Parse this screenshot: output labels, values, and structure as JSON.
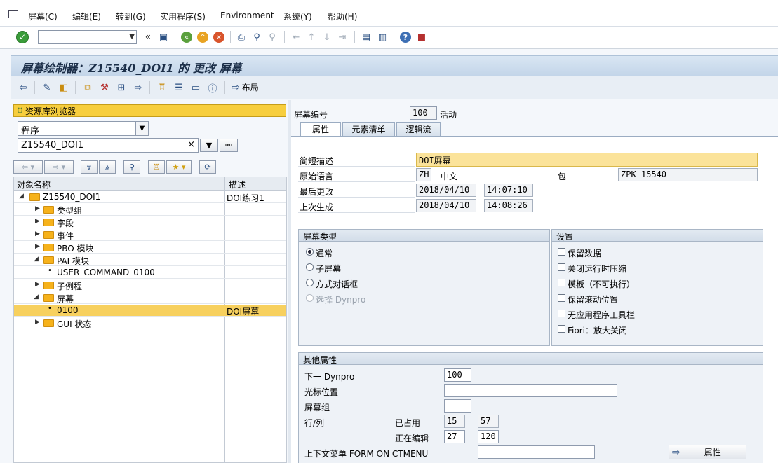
{
  "menu": [
    "屏幕(C)",
    "编辑(E)",
    "转到(G)",
    "实用程序(S)",
    "Environment",
    "系统(Y)",
    "帮助(H)"
  ],
  "title": "屏幕绘制器：Z15540_DOI1 的 更改 屏幕",
  "app_toolbar": {
    "layout_label": "布局"
  },
  "left": {
    "repo_browser": "资源库浏览器",
    "object_type": "程序",
    "object_name": "Z15540_DOI1",
    "col_name": "对象名称",
    "col_desc": "描述",
    "tree": [
      {
        "label": "Z15540_DOI1",
        "desc": "DOI练习1"
      },
      {
        "label": "类型组",
        "desc": ""
      },
      {
        "label": "字段",
        "desc": ""
      },
      {
        "label": "事件",
        "desc": ""
      },
      {
        "label": "PBO 模块",
        "desc": ""
      },
      {
        "label": "PAI 模块",
        "desc": ""
      },
      {
        "label": "USER_COMMAND_0100",
        "desc": ""
      },
      {
        "label": "子例程",
        "desc": ""
      },
      {
        "label": "屏幕",
        "desc": ""
      },
      {
        "label": "0100",
        "desc": "DOI屏幕"
      },
      {
        "label": "GUI 状态",
        "desc": ""
      }
    ]
  },
  "right": {
    "screen_no_label": "屏幕编号",
    "screen_no": "100",
    "status": "活动",
    "tabs": [
      "属性",
      "元素清单",
      "逻辑流"
    ],
    "short_desc_label": "简短描述",
    "short_desc": "DOI屏幕",
    "orig_lang_label": "原始语言",
    "orig_lang_code": "ZH",
    "orig_lang_name": "中文",
    "package_label": "包",
    "package": "ZPK_15540",
    "last_changed_label": "最后更改",
    "last_changed_date": "2018/04/10",
    "last_changed_time": "14:07:10",
    "last_gen_label": "上次生成",
    "last_gen_date": "2018/04/10",
    "last_gen_time": "14:08:26",
    "screen_type": {
      "header": "屏幕类型",
      "options": [
        "通常",
        "子屏幕",
        "方式对话框",
        "选择 Dynpro"
      ],
      "selected": 0
    },
    "settings": {
      "header": "设置",
      "options": [
        "保留数据",
        "关闭运行时压缩",
        "模板（不可执行）",
        "保留滚动位置",
        "无应用程序工具栏",
        "Fiori：放大关闭"
      ]
    },
    "other": {
      "header": "其他属性",
      "next_dynpro_label": "下一 Dynpro",
      "next_dynpro": "100",
      "cursor_label": "光标位置",
      "cursor": "",
      "screen_group_label": "屏幕组",
      "screen_group": "",
      "lines_cols_label": "行/列",
      "occupied_label": "已占用",
      "occupied_rows": "15",
      "occupied_cols": "57",
      "editing_label": "正在编辑",
      "editing_rows": "27",
      "editing_cols": "120",
      "ctx_menu_label": "上下文菜单 FORM ON CTMENU",
      "ctx_menu": "",
      "attr_button": "属性"
    }
  }
}
